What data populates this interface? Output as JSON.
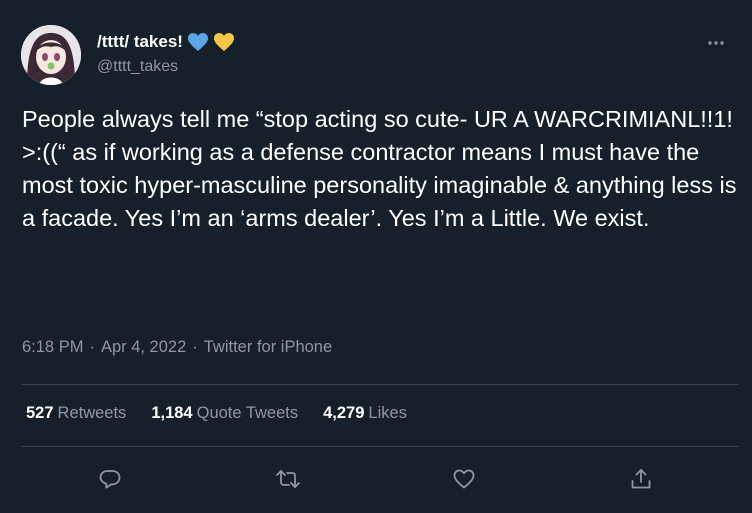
{
  "author": {
    "display_name": "/tttt/ takes!",
    "handle": "@tttt_takes",
    "badges": [
      "blue-heart-icon",
      "yellow-heart-icon"
    ],
    "badge_colors": [
      "#5ba4e6",
      "#f6c744"
    ]
  },
  "tweet": {
    "text": "People always tell me “stop acting so cute- UR A WARCRIMIANL!!1! >:((“ as if working as a defense contractor means I must have the most toxic hyper-masculine personality imaginable & anything less is a facade. Yes I’m an ‘arms dealer’. Yes I’m a Little. We exist.",
    "time": "6:18 PM",
    "date": "Apr 4, 2022",
    "source": "Twitter for iPhone",
    "separator": "·"
  },
  "stats": {
    "retweets": {
      "count": "527",
      "label": "Retweets"
    },
    "quotes": {
      "count": "1,184",
      "label": "Quote Tweets"
    },
    "likes": {
      "count": "4,279",
      "label": "Likes"
    }
  },
  "actions": [
    "reply-icon",
    "retweet-icon",
    "like-icon",
    "share-icon"
  ],
  "colors": {
    "background": "#15202b",
    "text": "#ffffff",
    "muted": "#8b98a5",
    "divider": "#38444d"
  }
}
